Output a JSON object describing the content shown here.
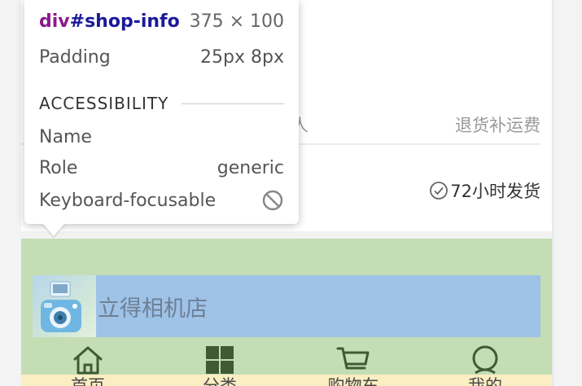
{
  "page": {
    "row1_left_partial": "人",
    "row1_right": "退货补运费",
    "ship_text": "72小时发货",
    "shop_name": "立得相机店"
  },
  "tooltip": {
    "tag": "div",
    "id": "#shop-info",
    "dimensions": "375 × 100",
    "padding_label": "Padding",
    "padding_value": "25px 8px",
    "section_title": "ACCESSIBILITY",
    "name_label": "Name",
    "name_value": "",
    "role_label": "Role",
    "role_value": "generic",
    "focus_label": "Keyboard-focusable"
  },
  "tabbar": {
    "items": [
      {
        "label": "首页",
        "icon": "home-icon"
      },
      {
        "label": "分类",
        "icon": "grid-icon"
      },
      {
        "label": "购物车",
        "icon": "cart-icon"
      },
      {
        "label": "我的",
        "icon": "user-icon"
      }
    ]
  },
  "colors": {
    "padding_highlight": "#c4ddb5",
    "content_highlight": "#9fc2e7",
    "tag_color": "#8b1a8a",
    "id_color": "#1a1a9a",
    "icon_color": "#3f5a34"
  }
}
